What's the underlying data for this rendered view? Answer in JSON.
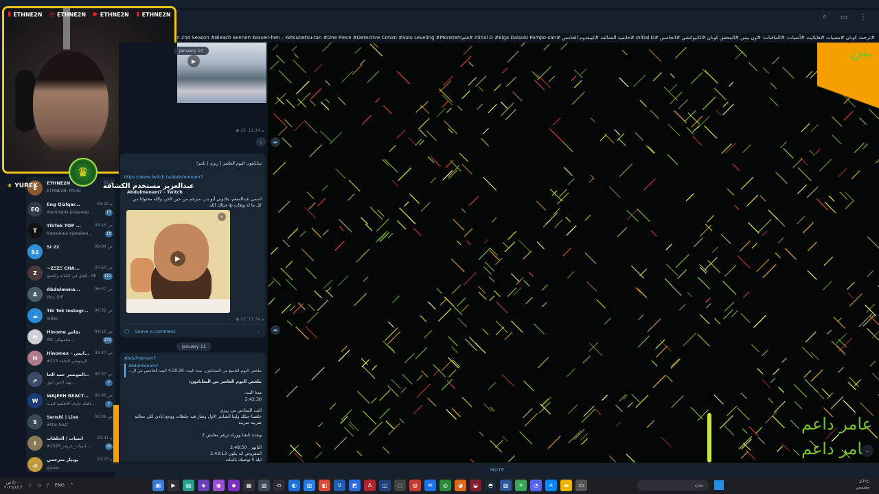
{
  "ticker": "#ترجمة كونان #مضيات #هايلايت #أنميات: #المافتات: #ون بيس #المحقق كونان #كانيواتشي #الخامس #Initial D #خاتمية العمالقة #كيبغدوم الخامس #Initial D #Elga Daisuki Pompo-san #قلمJujutsu Kaisen 2nd Season #Bleach Sennen Kessen-hen – Ketsubetsu-tan #One Piece #Detective Conan #Solo Leveling #Monsters# #ترجمة كونان #ثنتا السورة التقريرية #تحويلات# #كانيو كيد #هنتر #كيغدوم #البوت: #GT7 - 10# قليلا #المقدمة",
  "webcam": {
    "socials": [
      "ETHNE2N",
      "ETHNE2N",
      "ETHNE2N",
      "ETHNE2N"
    ],
    "username": "YUREK",
    "username_prefix": "★",
    "arabic_name": "عبدالعزيز مستخدم الكشافة"
  },
  "chats": [
    {
      "name": "ETHNE2N",
      "time": "03:3",
      "preview": "ETHNE2N: Photo",
      "avatar": "E",
      "color": "#8a5b2e"
    },
    {
      "name": "Eng Qizlqar...",
      "time": "09:29 م",
      "preview": "Авелларм дадажар...",
      "unread": "17",
      "avatar": "EQ",
      "color": "#2e3a4a"
    },
    {
      "name": "TikTok TOP ...",
      "time": "09:16 ص",
      "preview": "Кинчинка хўжайин...",
      "unread": "15",
      "avatar": "T",
      "color": "#111111"
    },
    {
      "name": "SI 22",
      "time": "09:04 ص",
      "preview": "",
      "avatar": "S2",
      "color": "#2f8fd6"
    },
    {
      "name": "~ZΞZΞ CHA...",
      "time": "07:50 ص",
      "preview": "القتل في الكتابة والشيخ...Mi",
      "unread": "112",
      "avatar": "Z",
      "color": "#4a3a3a"
    },
    {
      "name": "Abdulmena...",
      "time": "06:37 ص",
      "preview": "You: GIF",
      "avatar": "A",
      "color": "#4a5b6a"
    },
    {
      "name": "Tik Tok Instagr...",
      "time": "04:32 ص",
      "preview": "Video",
      "avatar": "☁",
      "color": "#2e8ad8"
    },
    {
      "name": "Hinome تقاش",
      "time": "04:16 ص",
      "preview": "Alt: ساميوكن...",
      "unread": "272",
      "avatar": "H",
      "color": "#cfcfd6"
    },
    {
      "name": "Hinomex - انمي...",
      "time": "03:47 ص",
      "preview": "#الرموشي الحلقة 215",
      "avatar": "H",
      "color": "#b07a8a"
    },
    {
      "name": "المونسر حمد الحا...",
      "time": "03:37 ص",
      "preview": "تهيد الدين عيق...",
      "unread": "7",
      "avatar": "م",
      "color": "#3a4a6a"
    },
    {
      "name": "WAJEEH REACT...",
      "time": "02:06 ص",
      "preview": "اقتام عارف #تعلمو اليوت...",
      "unread": "7",
      "avatar": "W",
      "color": "#1a3a7a"
    },
    {
      "name": "Senshi | Live",
      "time": "02:06 ص",
      "preview": "#the_best",
      "avatar": "S",
      "color": "#3a4a5a"
    },
    {
      "name": "انميات | الحلقات",
      "time": "10:41 م",
      "preview": "#انميات_خريف_2025...",
      "unread": "39",
      "avatar": "ا",
      "color": "#8a7a5a"
    },
    {
      "name": "يونيار مترجمي",
      "time": "10:03 م",
      "preview": "ضحضح",
      "avatar": "ي",
      "color": "#c49a3a"
    }
  ],
  "channel": {
    "date1": "January 10",
    "views1": "23",
    "time1": "11:34 م",
    "msg2_header": "سابانتون اليوم العاشر | ريزي | بانتر!",
    "msg2_link": "https://www.twitch.tv/abdulmenam7",
    "msg2_card_title": "Abdulmenam7 - Twitch",
    "msg2_body": "اسمي عبدالمنعم، بلادوني أبو بدر، مترجم من حين لآخر، والله محتوانا من كل ما لذ وطاب ip حيالك الله",
    "views2": "23",
    "time2": "11:34 م",
    "comment_label": "Leave a comment",
    "date2": "January 11",
    "msg3_author": "Abdulmenam7",
    "msg3_quote_author": "Abdulmenam7",
    "msg3_quote": "ملخص اليوم التاسع من السابانون: مدة البث: 4:39:29 البث الخامس من ال...",
    "msg3_lines": [
      "ملخص اليوم العاشر من السابانون:",
      "مدة البث:",
      "5:42:30",
      "البث السادس من ريزي",
      "خلصنا حيلك ولينا الشابتر الاول وصار فيه جلطات ووجع ايادي لكن معاليه ضريبة ضريبة",
      "وبعده تابعنا وورلد تريفر معايش 2",
      "التابهر : 2:48:50",
      "المفروض انه يكون 2:43:13",
      "ايلد لا توصيك بالبنانه"
    ]
  },
  "wallpaper_text": [
    "عامر داعم",
    "عامر داعم"
  ],
  "mute_label": "MUTE",
  "taskbar": {
    "lang": "ENG",
    "clock_time": "٥:٠٠ ص",
    "clock_date": "٢٠٢٦/١/١٣",
    "search_placeholder": "بحث",
    "weather_temp": "27°C",
    "weather_desc": "مشمس"
  }
}
